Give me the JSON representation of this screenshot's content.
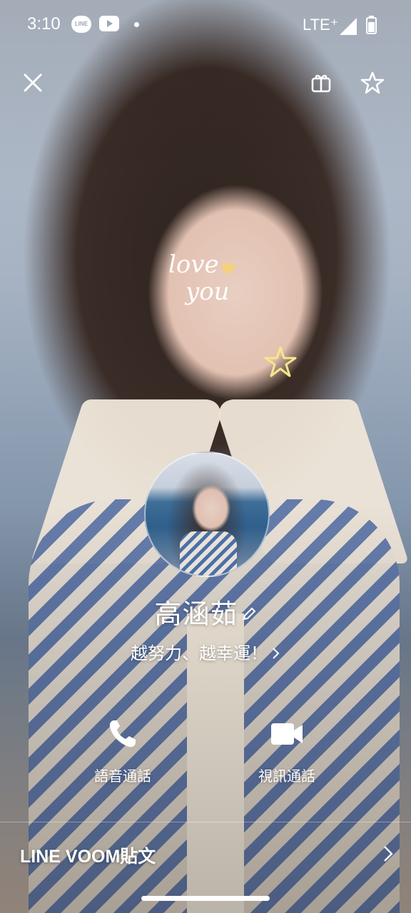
{
  "status_bar": {
    "time": "3:10",
    "line_icon_text": "LINE",
    "network": "LTE⁺",
    "icons": [
      "line-app-icon",
      "youtube-icon",
      "notification-dot-icon",
      "signal-icon",
      "battery-icon"
    ]
  },
  "top_bar": {
    "icons": [
      "close-icon",
      "gift-icon",
      "star-icon"
    ]
  },
  "background_sticker": {
    "line1": "love",
    "line2": "you"
  },
  "profile": {
    "name": "高涵茹",
    "status_message": "越努力、越幸運！",
    "edit_icon": "pencil-icon"
  },
  "actions": {
    "voice_call_label": "語音通話",
    "video_call_label": "視訊通話",
    "voice_icon": "phone-icon",
    "video_icon": "video-camera-icon"
  },
  "voom": {
    "label": "LINE VOOM貼文"
  },
  "colors": {
    "text": "#ffffff",
    "sticker_heart": "#f4d27a"
  }
}
